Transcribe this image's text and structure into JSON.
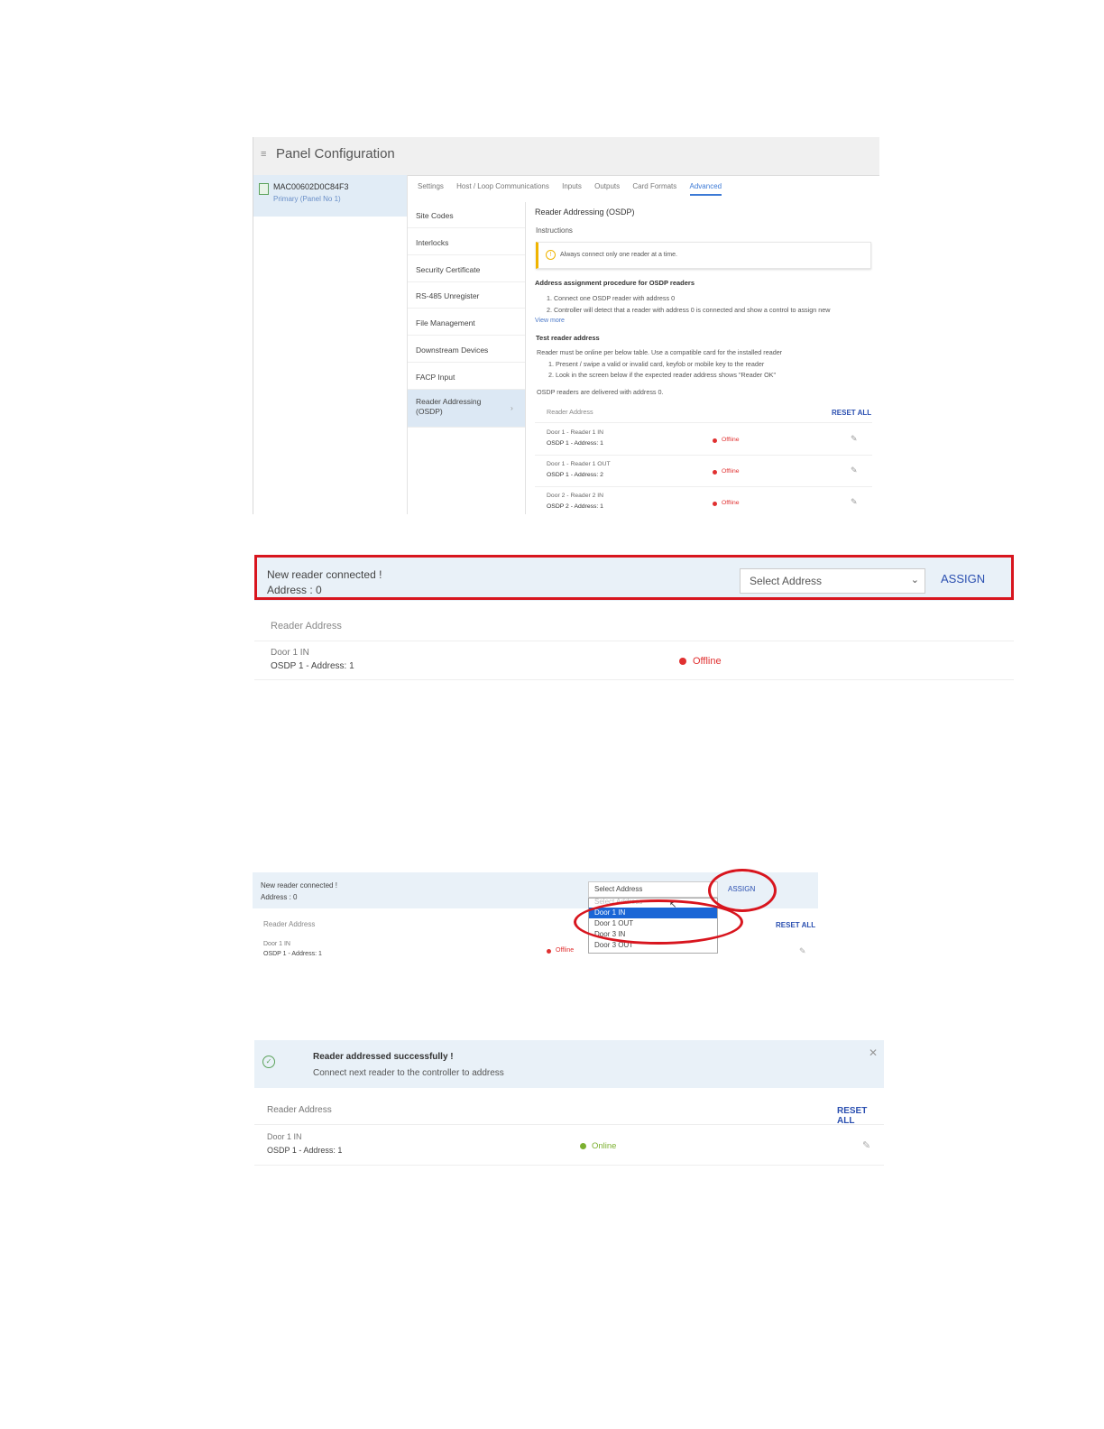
{
  "shot1": {
    "header_title": "Panel Configuration",
    "panel_id": "MAC00602D0C84F3",
    "panel_sub": "Primary (Panel No 1)",
    "tabs": [
      {
        "label": "Settings"
      },
      {
        "label": "Host / Loop Communications"
      },
      {
        "label": "Inputs"
      },
      {
        "label": "Outputs"
      },
      {
        "label": "Card Formats"
      },
      {
        "label": "Advanced"
      }
    ],
    "active_tab": "Advanced",
    "nav": [
      {
        "label": "Site Codes"
      },
      {
        "label": "Interlocks"
      },
      {
        "label": "Security Certificate"
      },
      {
        "label": "RS-485 Unregister"
      },
      {
        "label": "File Management"
      },
      {
        "label": "Downstream Devices"
      },
      {
        "label": "FACP Input"
      },
      {
        "label": "Reader Addressing (OSDP)"
      }
    ],
    "content": {
      "title": "Reader Addressing (OSDP)",
      "instructions": "Instructions",
      "alert": "Always connect only one reader at a time.",
      "proc_title": "Address assignment procedure for OSDP readers",
      "proc_1": "1. Connect one OSDP reader with address 0",
      "proc_2": "2. Controller will detect that a reader with address 0 is connected and show a control to assign new",
      "view_more": "View more",
      "test_title": "Test reader address",
      "test_desc": "Reader must be online per below table. Use a compatible card for the installed reader",
      "test_1": "1. Present / swipe a valid or invalid card, keyfob or mobile key to the reader",
      "test_2": "2. Look in the screen below if the expected reader address shows \"Reader OK\"",
      "delivered": "OSDP readers are delivered with address 0.",
      "col_header": "Reader Address",
      "reset_all": "RESET ALL",
      "rows": [
        {
          "name": "Door 1 - Reader 1 IN",
          "osdp": "OSDP 1 - Address: 1",
          "status": "Offline"
        },
        {
          "name": "Door 1 - Reader 1 OUT",
          "osdp": "OSDP 1 - Address: 2",
          "status": "Offline"
        },
        {
          "name": "Door 2 - Reader 2 IN",
          "osdp": "OSDP 2 - Address: 1",
          "status": "Offline"
        }
      ]
    }
  },
  "shot2": {
    "msg1": "New reader connected !",
    "msg2": "Address : 0",
    "select_value": "Select Address",
    "assign": "ASSIGN",
    "col_header": "Reader Address",
    "row_name": "Door 1 IN",
    "row_osdp": "OSDP 1 - Address: 1",
    "row_status": "Offline"
  },
  "shot3": {
    "msg1": "New reader connected !",
    "msg2": "Address : 0",
    "select_value": "Select Address",
    "assign": "ASSIGN",
    "options": [
      "Select Address",
      "Door 1 IN",
      "Door 1 OUT",
      "Door 3 IN",
      "Door 3 OUT"
    ],
    "selected_option": "Door 1 IN",
    "col_header": "Reader Address",
    "reset_all": "RESET ALL",
    "row_name": "Door 1 IN",
    "row_osdp": "OSDP 1 - Address: 1",
    "row_status": "Offline"
  },
  "shot4": {
    "msg1": "Reader addressed successfully !",
    "msg2": "Connect next reader to the controller to address",
    "col_header": "Reader Address",
    "reset_all": "RESET ALL",
    "row_name": "Door 1 IN",
    "row_osdp": "OSDP 1 - Address: 1",
    "row_status": "Online"
  },
  "colors": {
    "accent": "#2a4fb0",
    "highlight": "#d8151e",
    "offline": "#e03030",
    "online": "#7cb030",
    "banner_bg": "#e9f1f8"
  }
}
